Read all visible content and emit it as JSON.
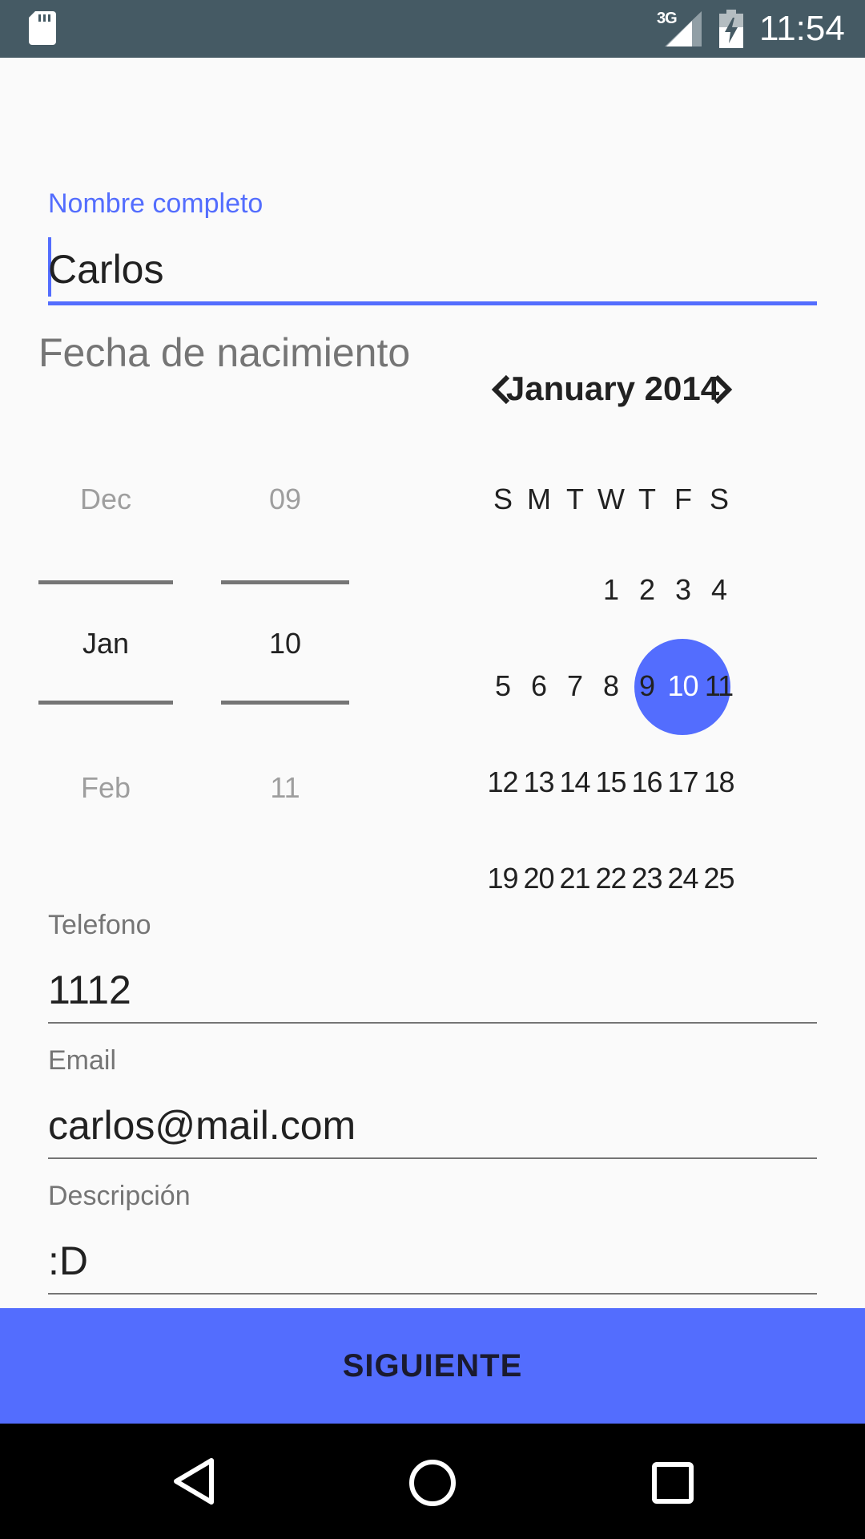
{
  "status_bar": {
    "network": "3G",
    "time": "11:54",
    "icons": [
      "sd-card-icon",
      "signal-icon",
      "battery-charging-icon"
    ]
  },
  "form": {
    "name": {
      "label": "Nombre completo",
      "value": "Carlos"
    },
    "birth_date": {
      "label": "Fecha de nacimiento",
      "month_spinner": {
        "prev": "Dec",
        "selected": "Jan",
        "next": "Feb"
      },
      "day_spinner": {
        "prev": "09",
        "selected": "10",
        "next": "11"
      }
    },
    "phone": {
      "label": "Telefono",
      "value": "1112"
    },
    "email": {
      "label": "Email",
      "value": "carlos@mail.com"
    },
    "description": {
      "label": "Descripción",
      "value": ":D"
    }
  },
  "calendar": {
    "header": "January 2014",
    "weekdays": [
      "S",
      "M",
      "T",
      "W",
      "T",
      "F",
      "S"
    ],
    "selected_day": "10",
    "weeks": [
      [
        "",
        "",
        "",
        "1",
        "2",
        "3",
        "4"
      ],
      [
        "5",
        "6",
        "7",
        "8",
        "9",
        "10",
        "11"
      ],
      [
        "12",
        "13",
        "14",
        "15",
        "16",
        "17",
        "18"
      ],
      [
        "19",
        "20",
        "21",
        "22",
        "23",
        "24",
        "25"
      ]
    ]
  },
  "next_button": {
    "label": "SIGUIENTE"
  },
  "nav_bar": {
    "icons": [
      "back-icon",
      "home-icon",
      "recents-icon"
    ]
  },
  "colors": {
    "accent": "#536dfe",
    "status_bar": "#455a64",
    "background": "#fafafa"
  }
}
